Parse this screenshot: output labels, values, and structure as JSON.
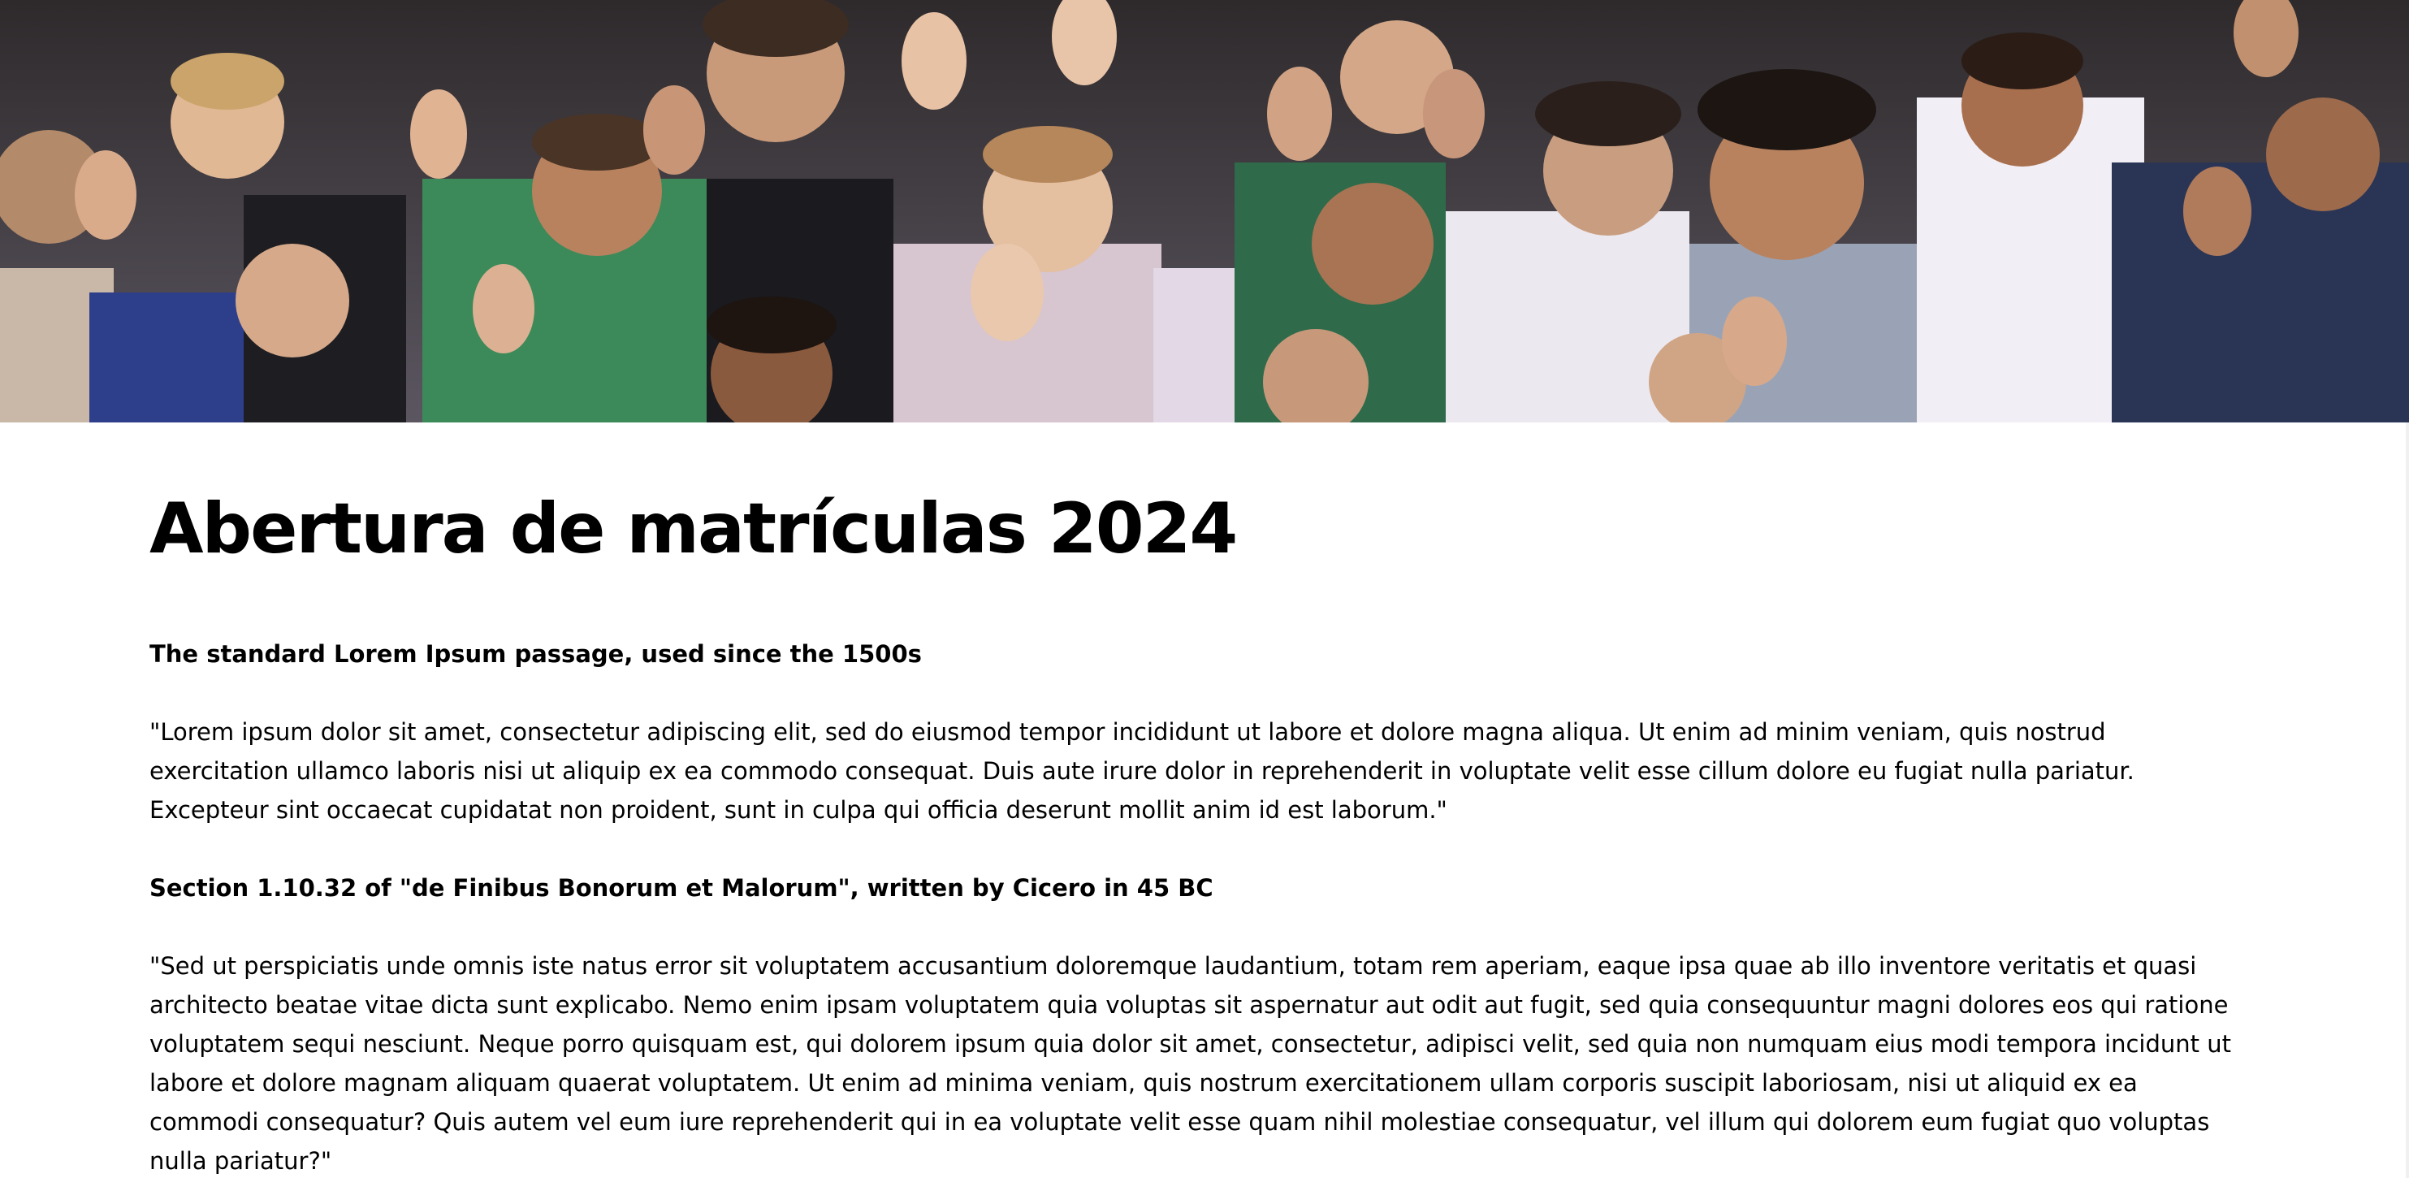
{
  "hero": {
    "image_description_icon": "photo-icon"
  },
  "article": {
    "title": "Abertura de matrículas 2024",
    "section1_heading": "The standard Lorem Ipsum passage, used since the 1500s",
    "section1_text": "\"Lorem ipsum dolor sit amet, consectetur adipiscing elit, sed do eiusmod tempor incididunt ut labore et dolore magna aliqua. Ut enim ad minim veniam, quis nostrud exercitation ullamco laboris nisi ut aliquip ex ea commodo consequat. Duis aute irure dolor in reprehenderit in voluptate velit esse cillum dolore eu fugiat nulla pariatur. Excepteur sint occaecat cupidatat non proident, sunt in culpa qui officia deserunt mollit anim id est laborum.\"",
    "section2_heading": "Section 1.10.32 of \"de Finibus Bonorum et Malorum\", written by Cicero in 45 BC",
    "section2_text": "\"Sed ut perspiciatis unde omnis iste natus error sit voluptatem accusantium doloremque laudantium, totam rem aperiam, eaque ipsa quae ab illo inventore veritatis et quasi architecto beatae vitae dicta sunt explicabo. Nemo enim ipsam voluptatem quia voluptas sit aspernatur aut odit aut fugit, sed quia consequuntur magni dolores eos qui ratione voluptatem sequi nesciunt. Neque porro quisquam est, qui dolorem ipsum quia dolor sit amet, consectetur, adipisci velit, sed quia non numquam eius modi tempora incidunt ut labore et dolore magnam aliquam quaerat voluptatem. Ut enim ad minima veniam, quis nostrum exercitationem ullam corporis suscipit laboriosam, nisi ut aliquid ex ea commodi consequatur? Quis autem vel eum iure reprehenderit qui in ea voluptate velit esse quam nihil molestiae consequatur, vel illum qui dolorem eum fugiat quo voluptas nulla pariatur?\""
  }
}
